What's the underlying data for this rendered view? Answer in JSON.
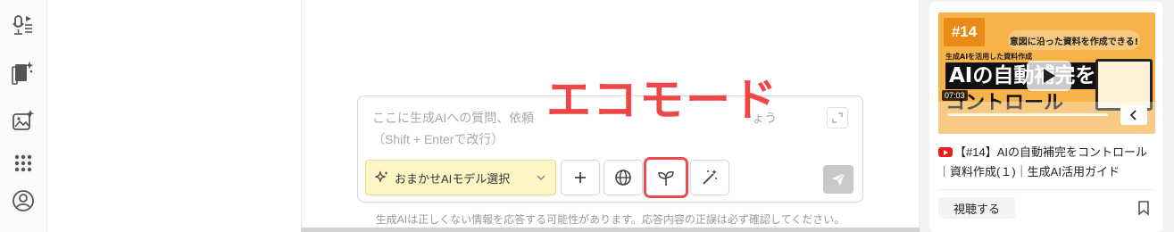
{
  "composer": {
    "placeholder_line1": "ここに生成AIへの質問、依頼",
    "placeholder_line1_tail": "ょう",
    "placeholder_line2": "（Shift + Enterで改行）",
    "model_select_label": "おまかせAIモデル選択"
  },
  "callout": {
    "text": "エコモード"
  },
  "disclaimer": "生成AIは正しくない情報を応答する可能性があります。応答内容の正誤は必ず確認してください。",
  "video": {
    "badge": "#14",
    "ribbon": "意図に沿った資料を作成できる!",
    "thumb_sub": "生成AIを活用した資料作成",
    "thumb_big1": "AIの自動補完を",
    "thumb_big2": "コントロール",
    "duration": "07:03",
    "title": "【#14】AIの自動補完をコントロール｜資料作成(１)｜生成AI活用ガイド",
    "watch_label": "視聴する"
  },
  "colors": {
    "accent_red": "#ef4747",
    "model_bg": "#fff6c8",
    "thumb_orange": "#f7b24a"
  },
  "icons": [
    "voice-list-icon",
    "doc-sparkle-icon",
    "image-sparkle-icon",
    "apps-grid-icon",
    "user-circle-icon",
    "expand-icon",
    "sparkle-icon",
    "chevron-down-icon",
    "plus-icon",
    "globe-icon",
    "sprout-icon",
    "magic-wand-icon",
    "send-icon",
    "play-icon",
    "chevron-left-icon",
    "youtube-icon",
    "bookmark-icon"
  ]
}
